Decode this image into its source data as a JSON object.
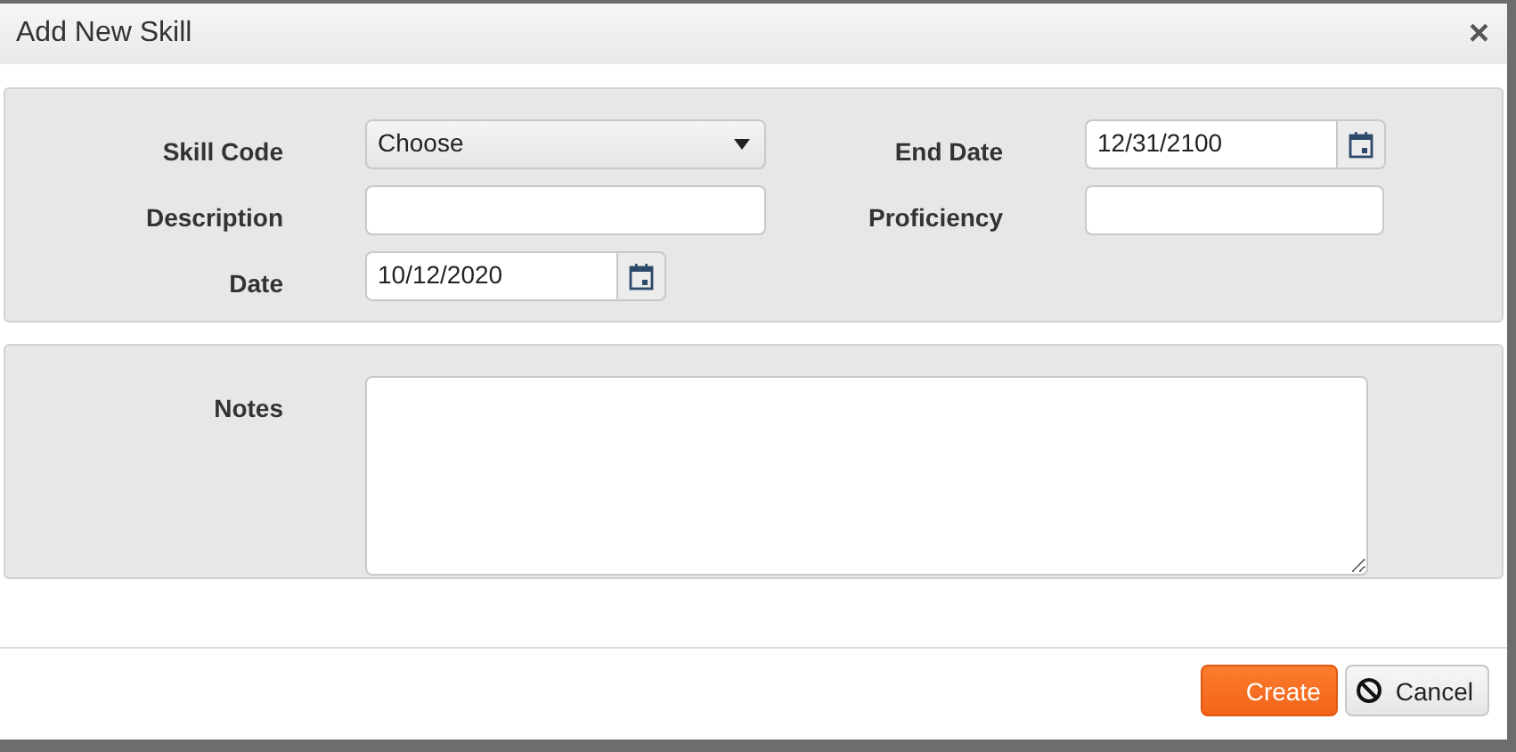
{
  "dialog": {
    "title": "Add New Skill",
    "close": "×"
  },
  "fields_left": [
    {
      "label": "Skill Code",
      "kind": "select",
      "value": "Choose"
    },
    {
      "label": "Description",
      "kind": "text"
    },
    {
      "label": "Date",
      "kind": "date",
      "value": "10/12/2020"
    }
  ],
  "fields_right": [
    {
      "label": "End Date",
      "kind": "date",
      "value": "12/31/2100"
    },
    {
      "label": "Proficiency",
      "kind": "text"
    }
  ],
  "notes": {
    "label": "Notes"
  },
  "buttons": [
    {
      "label": "Create",
      "kind": "primary"
    },
    {
      "label": "Cancel",
      "kind": "cancel"
    }
  ]
}
